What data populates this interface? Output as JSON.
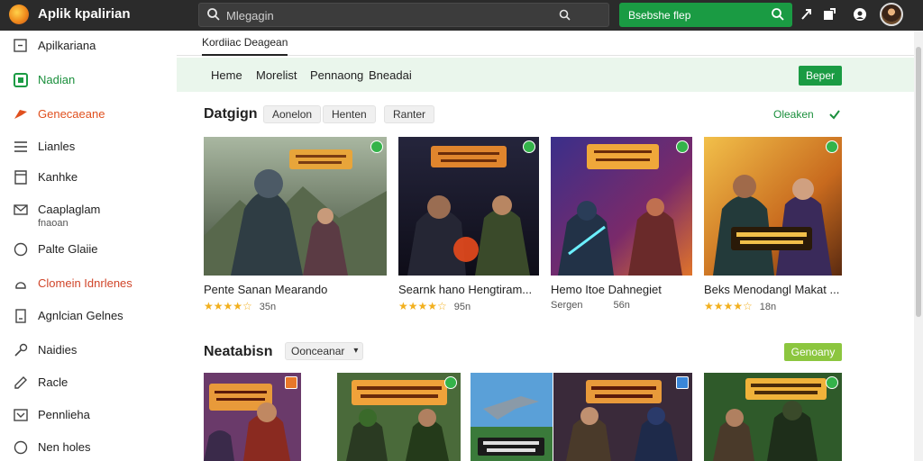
{
  "header": {
    "title": "Aplik kpalirian",
    "search_placeholder": "Mlegagin",
    "green_search_text": "Bsebshe flep"
  },
  "sidebar": {
    "items": [
      {
        "label": "Apilkariana",
        "icon": "square-icon",
        "style": "normal"
      },
      {
        "label": "Nadian",
        "icon": "apps-icon",
        "style": "green"
      },
      {
        "label": "Genecaeane",
        "icon": "fire-icon",
        "style": "orange"
      },
      {
        "label": "Lianles",
        "icon": "list-icon",
        "style": "normal"
      },
      {
        "label": "Kanhke",
        "icon": "bookmark-icon",
        "style": "normal"
      },
      {
        "label": "Caaplaglam",
        "sub": "fnaoan",
        "icon": "mail-icon",
        "style": "normal"
      },
      {
        "label": "Palte Glaiie",
        "icon": "circle-icon",
        "style": "normal"
      },
      {
        "label": "Clomein Idnrlenes",
        "icon": "cloud-icon",
        "style": "red"
      },
      {
        "label": "Agnlcian Gelnes",
        "icon": "doc-icon",
        "style": "normal"
      },
      {
        "label": "Naidies",
        "icon": "key-icon",
        "style": "normal"
      },
      {
        "label": "Racle",
        "icon": "pencil-icon",
        "style": "normal"
      },
      {
        "label": "Pennlieha",
        "icon": "inbox-icon",
        "style": "normal"
      },
      {
        "label": "Nen holes",
        "icon": "circle-outline-icon",
        "style": "normal"
      }
    ]
  },
  "main": {
    "tab_label": "Kordiiac Deagean",
    "nav_links": [
      "Heme",
      "Morelist",
      "Pennaong",
      "Bneadai"
    ],
    "nav_button": "Beper",
    "section1": {
      "title": "Datgign",
      "chips": [
        "Aonelon",
        "Henten",
        "Ranter"
      ],
      "more": "Oleaken",
      "cards": [
        {
          "title": "Pente Sanan Mearando",
          "stars": "★★★★☆",
          "count": "35n",
          "badge": "green"
        },
        {
          "title": "Searnk hano Hengtiram...",
          "stars": "★★★★☆",
          "count": "95n",
          "badge": "green"
        },
        {
          "title": "Hemo Itoe Dahnegiet",
          "meta": "Sergen",
          "count": "56n",
          "badge": "green"
        },
        {
          "title": "Beks Menodangl Makat ...",
          "stars": "★★★★☆",
          "count": "18n",
          "badge": "green"
        }
      ]
    },
    "section2": {
      "title": "Neatabisn",
      "dropdown": "Oonceanar",
      "button": "Genoany"
    }
  }
}
